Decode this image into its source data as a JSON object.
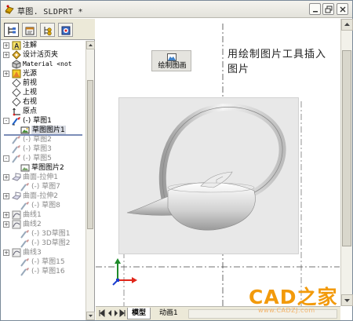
{
  "window": {
    "title": "草图. SLDPRT *"
  },
  "feature_tabs": [
    {
      "name": "feature-manager",
      "icon": "feature-tree-icon",
      "active": true
    },
    {
      "name": "property-manager",
      "icon": "property-sheet-icon",
      "active": false
    },
    {
      "name": "configuration-manager",
      "icon": "configuration-icon",
      "active": false
    },
    {
      "name": "display-manager",
      "icon": "display-icon",
      "active": false
    }
  ],
  "tree": {
    "items": [
      {
        "label": "注解",
        "icon": "annotations-icon",
        "expander": "+"
      },
      {
        "label": "设计活页夹",
        "icon": "design-binder-icon",
        "expander": "+"
      },
      {
        "label": "Material <not",
        "icon": "material-icon",
        "expander": ""
      },
      {
        "label": "光源",
        "icon": "lights-icon",
        "expander": "+"
      },
      {
        "label": "前视",
        "icon": "plane-icon",
        "expander": ""
      },
      {
        "label": "上视",
        "icon": "plane-icon",
        "expander": ""
      },
      {
        "label": "右视",
        "icon": "plane-icon",
        "expander": ""
      },
      {
        "label": "原点",
        "icon": "origin-icon",
        "expander": ""
      },
      {
        "label": "(-) 草图1",
        "icon": "sketch-icon",
        "expander": "-"
      },
      {
        "label": "草图图片1",
        "icon": "sketch-picture-icon",
        "expander": ""
      },
      {
        "label": "(-) 草图2",
        "icon": "sketch-icon",
        "expander": ""
      },
      {
        "label": "(-) 草图3",
        "icon": "sketch-icon",
        "expander": ""
      },
      {
        "label": "(-) 草图5",
        "icon": "sketch-icon",
        "expander": "-"
      },
      {
        "label": "草图图片2",
        "icon": "sketch-picture-icon",
        "expander": ""
      },
      {
        "label": "曲面-拉伸1",
        "icon": "surface-extrude-icon",
        "expander": "+"
      },
      {
        "label": "(-) 草图7",
        "icon": "sketch-icon",
        "expander": ""
      },
      {
        "label": "曲面-拉伸2",
        "icon": "surface-extrude-icon",
        "expander": "+"
      },
      {
        "label": "(-) 草图8",
        "icon": "sketch-icon",
        "expander": ""
      },
      {
        "label": "曲线1",
        "icon": "curve-icon",
        "expander": "+"
      },
      {
        "label": "曲线2",
        "icon": "curve-icon",
        "expander": "+"
      },
      {
        "label": "(-) 3D草图1",
        "icon": "3d-sketch-icon",
        "expander": ""
      },
      {
        "label": "(-) 3D草图2",
        "icon": "3d-sketch-icon",
        "expander": ""
      },
      {
        "label": "曲线3",
        "icon": "curve-icon",
        "expander": "+"
      },
      {
        "label": "(-) 草图15",
        "icon": "sketch-icon",
        "expander": ""
      },
      {
        "label": "(-) 草图16",
        "icon": "sketch-icon",
        "expander": ""
      }
    ]
  },
  "graphics": {
    "sketch_picture_button_label": "绘制图画",
    "note_text": "用绘制图片工具插入图片"
  },
  "bottom_tabs": [
    {
      "label": "模型",
      "active": true
    },
    {
      "label": "动画1",
      "active": false
    }
  ],
  "watermark": {
    "logo_text": "CAD之家",
    "site_text": "www.CADZJ.com"
  },
  "colors": {
    "rollback_bar": "#7b8db7",
    "watermark": "#f29a0b",
    "axis_x": "#e0261a",
    "axis_y": "#1f8a2a",
    "axis_z": "#1c3fd0"
  }
}
